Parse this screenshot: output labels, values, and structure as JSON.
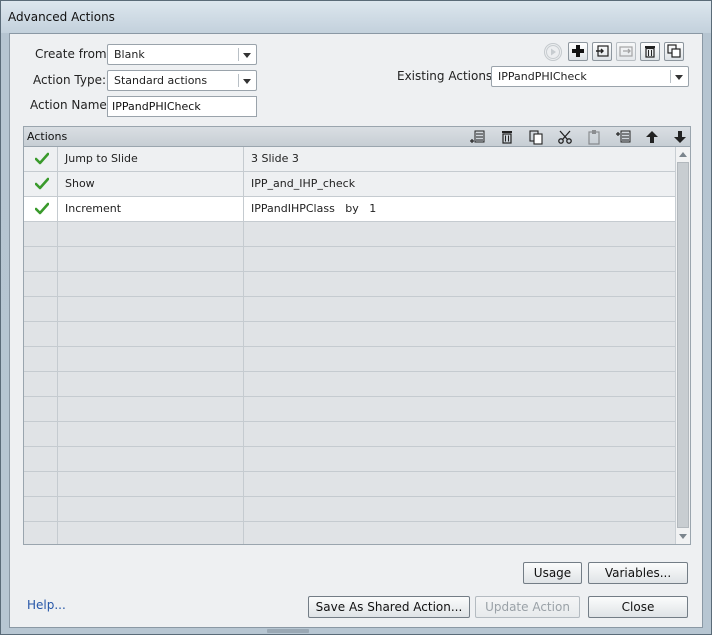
{
  "window": {
    "title": "Advanced Actions"
  },
  "form": {
    "create_from_label": "Create from:",
    "create_from_value": "Blank",
    "action_type_label": "Action Type:",
    "action_type_value": "Standard actions",
    "action_name_label": "Action Name:",
    "action_name_value": "IPPandPHICheck",
    "existing_actions_label": "Existing Actions:",
    "existing_actions_value": "IPPandPHICheck"
  },
  "toolbar_icons": [
    "preview-icon",
    "add-icon",
    "import-icon",
    "export-icon",
    "delete-icon",
    "duplicate-icon"
  ],
  "grid": {
    "title": "Actions",
    "header_icons": [
      "insert-row-icon",
      "delete-row-icon",
      "copy-icon",
      "cut-icon",
      "paste-icon",
      "insert-below-icon",
      "move-up-icon",
      "move-down-icon"
    ],
    "rows": [
      {
        "status": "check",
        "action": "Jump to Slide",
        "target": "3 Slide 3"
      },
      {
        "status": "check",
        "action": "Show",
        "target": "IPP_and_IHP_check"
      },
      {
        "status": "check",
        "action": "Increment",
        "target": "IPPandIHPClass   by   1"
      }
    ],
    "selected_row": 2,
    "empty_rows": 13
  },
  "buttons": {
    "usage": "Usage",
    "variables": "Variables...",
    "help": "Help...",
    "save_shared": "Save As Shared Action...",
    "update_action": "Update Action",
    "close": "Close"
  },
  "colors": {
    "check": "#3a9a2c",
    "link": "#2556a8"
  }
}
